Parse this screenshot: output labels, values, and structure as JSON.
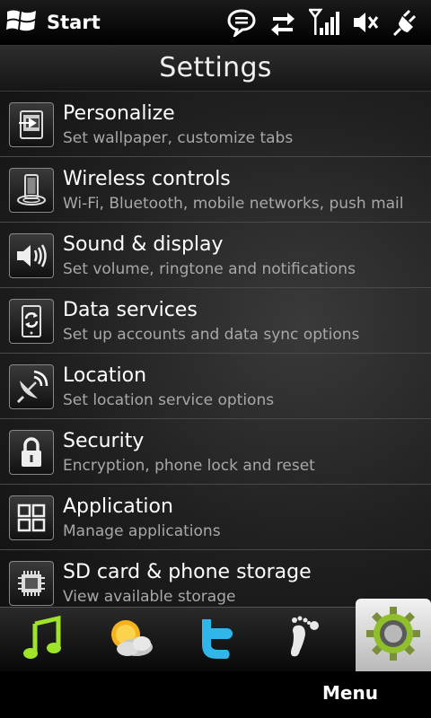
{
  "status_bar": {
    "start_label": "Start",
    "icons": [
      "windows-logo-icon",
      "messaging-icon",
      "data-transfer-icon",
      "signal-strength-icon",
      "speaker-muted-icon",
      "charging-plug-icon"
    ]
  },
  "header": {
    "title": "Settings"
  },
  "settings_items": [
    {
      "icon": "personalize-icon",
      "title": "Personalize",
      "subtitle": "Set wallpaper, customize tabs"
    },
    {
      "icon": "wireless-icon",
      "title": "Wireless controls",
      "subtitle": "Wi-Fi, Bluetooth, mobile networks, push mail"
    },
    {
      "icon": "speaker-icon",
      "title": "Sound & display",
      "subtitle": "Set volume, ringtone and notifications"
    },
    {
      "icon": "data-sync-icon",
      "title": "Data services",
      "subtitle": "Set up accounts and data sync options"
    },
    {
      "icon": "satellite-dish-icon",
      "title": "Location",
      "subtitle": "Set location service options"
    },
    {
      "icon": "lock-icon",
      "title": "Security",
      "subtitle": "Encryption, phone lock and reset"
    },
    {
      "icon": "app-grid-icon",
      "title": "Application",
      "subtitle": "Manage applications"
    },
    {
      "icon": "memory-chip-icon",
      "title": "SD card & phone storage",
      "subtitle": "View available storage"
    }
  ],
  "tab_bar": {
    "tabs": [
      "music-note-icon",
      "weather-icon",
      "twitter-icon",
      "footprints-icon",
      "settings-gear-icon"
    ],
    "active": "settings-gear-icon"
  },
  "softkeys": {
    "right_label": "Menu"
  },
  "colors": {
    "background": "#000000",
    "subtitle": "#a8a8a8",
    "music_green": "#9fe32b",
    "twitter_blue": "#30b6e8",
    "gear_green": "#8fbf2a"
  }
}
